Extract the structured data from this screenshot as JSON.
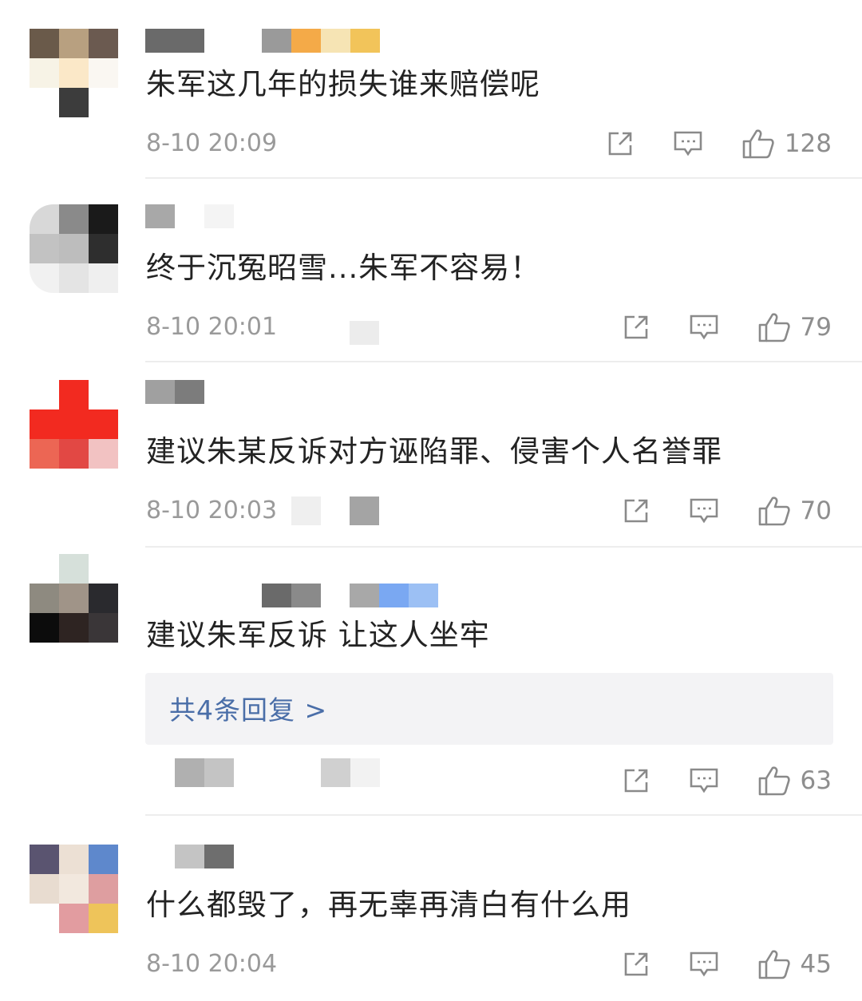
{
  "comments": [
    {
      "text": "朱军这几年的损失谁来赔偿呢",
      "time": "8-10 20:09",
      "likes": "128"
    },
    {
      "text": "终于沉冤昭雪...朱军不容易！",
      "time": "8-10 20:01",
      "likes": "79"
    },
    {
      "text": "建议朱某反诉对方诬陷罪、侵害个人名誉罪",
      "time": "8-10 20:03",
      "likes": "70"
    },
    {
      "text": "建议朱军反诉 让这人坐牢",
      "time": "",
      "likes": "63",
      "replies": "共4条回复 >"
    },
    {
      "text": "什么都毁了，再无辜再清白有什么用",
      "time": "8-10 20:04",
      "likes": "45"
    }
  ],
  "icons": {
    "share": "share-icon",
    "reply": "comment-icon",
    "like": "thumbs-up-icon"
  },
  "colors": {
    "link": "#4a6ea8",
    "meta": "#9a9a9a",
    "divider": "#ededed"
  }
}
